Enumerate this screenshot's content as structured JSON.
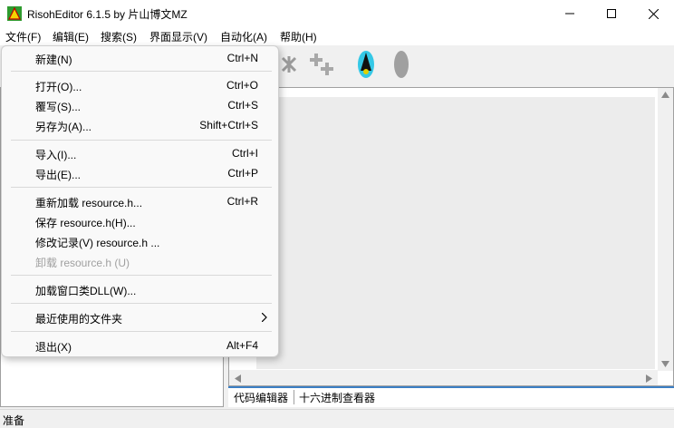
{
  "window": {
    "title": "RisohEditor 6.1.5 by 片山博文MZ"
  },
  "menubar": {
    "items": [
      "文件(F)",
      "编辑(E)",
      "搜索(S)",
      "界面显示(V)",
      "自动化(A)",
      "帮助(H)"
    ]
  },
  "file_menu": {
    "items": [
      {
        "label": "新建(N)",
        "shortcut": "Ctrl+N"
      },
      {
        "label": "打开(O)...",
        "shortcut": "Ctrl+O"
      },
      {
        "label": "覆写(S)...",
        "shortcut": "Ctrl+S"
      },
      {
        "label": "另存为(A)...",
        "shortcut": "Shift+Ctrl+S"
      },
      {
        "label": "导入(I)...",
        "shortcut": "Ctrl+I"
      },
      {
        "label": "导出(E)...",
        "shortcut": "Ctrl+P"
      },
      {
        "label": "重新加载 resource.h...",
        "shortcut": "Ctrl+R"
      },
      {
        "label": "保存 resource.h(H)...",
        "shortcut": ""
      },
      {
        "label": "修改记录(V) resource.h ...",
        "shortcut": ""
      },
      {
        "label": "卸载 resource.h (U)",
        "shortcut": "",
        "disabled": true
      },
      {
        "label": "加载窗口类DLL(W)...",
        "shortcut": ""
      },
      {
        "label": "最近使用的文件夹",
        "shortcut": "",
        "submenu": true
      },
      {
        "label": "退出(X)",
        "shortcut": "Alt+F4"
      }
    ]
  },
  "editor_tabs": [
    "代码编辑器",
    "十六进制查看器"
  ],
  "status": {
    "text": "准备"
  },
  "colors": {
    "accent": "#3c7fc4",
    "disabled": "#a0a0a0"
  }
}
